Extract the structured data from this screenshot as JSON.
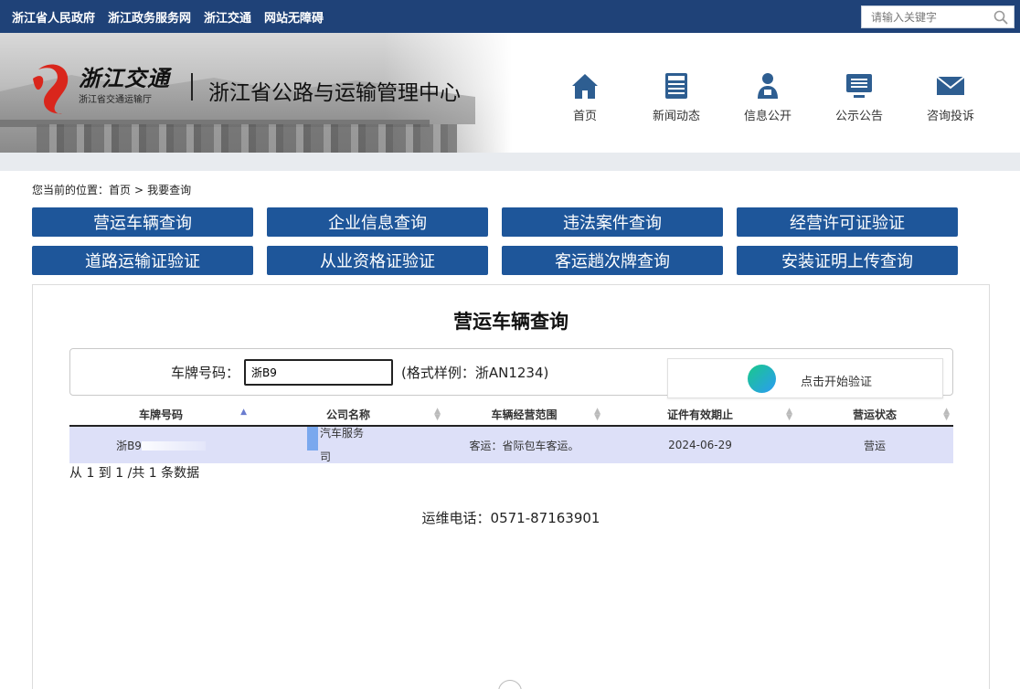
{
  "top_links": [
    "浙江省人民政府",
    "浙江政务服务网",
    "浙江交通",
    "网站无障碍"
  ],
  "search": {
    "placeholder": "请输入关键字",
    "icon": "search-icon"
  },
  "logo": {
    "main": "浙江交通",
    "sub": "浙江省交通运输厅"
  },
  "site_title": "浙江省公路与运输管理中心",
  "nav": [
    {
      "label": "首页",
      "icon": "home-icon"
    },
    {
      "label": "新闻动态",
      "icon": "news-icon"
    },
    {
      "label": "信息公开",
      "icon": "person-icon"
    },
    {
      "label": "公示公告",
      "icon": "monitor-icon"
    },
    {
      "label": "咨询投诉",
      "icon": "mail-icon"
    }
  ],
  "colors": {
    "topbar": "#1f4278",
    "button": "#1e569a",
    "row_highlight": "#dde0f8"
  },
  "breadcrumb": {
    "prefix": "您当前的位置：",
    "home": "首页",
    "sep": ">",
    "current": "我要查询"
  },
  "query_buttons": [
    "营运车辆查询",
    "企业信息查询",
    "违法案件查询",
    "经营许可证验证",
    "道路运输证验证",
    "从业资格证验证",
    "客运趟次牌查询",
    "安装证明上传查询"
  ],
  "panel": {
    "title": "营运车辆查询",
    "plate_label": "车牌号码：",
    "plate_value": "浙B9",
    "format_hint": "(格式样例：浙AN1234)",
    "verify_text": "点击开始验证",
    "columns": [
      "车牌号码",
      "公司名称",
      "车辆经营范围",
      "证件有效期止",
      "营运状态"
    ],
    "rows": [
      {
        "plate": "浙B9",
        "company_line1": "汽车服务",
        "company_line2": "司",
        "scope": "客运：省际包车客运。",
        "expiry": "2024-06-29",
        "status": "营运"
      }
    ],
    "page_info": "从 1 到 1 /共 1 条数据",
    "hotline": "运维电话：0571-87163901"
  }
}
